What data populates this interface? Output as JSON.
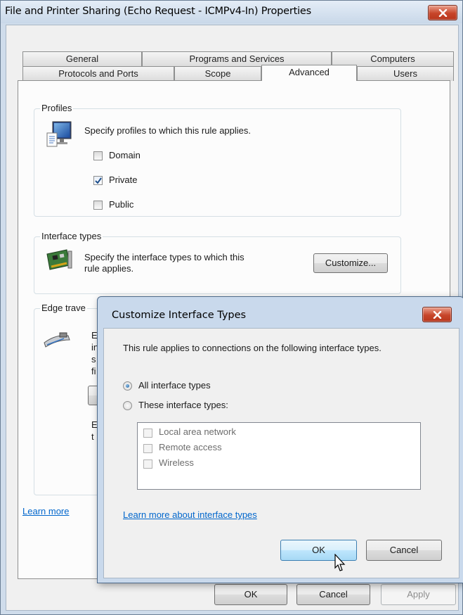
{
  "window": {
    "title": "File and Printer Sharing (Echo Request - ICMPv4-In) Properties",
    "close_label": "close"
  },
  "tabs": {
    "row1": [
      "General",
      "Programs and Services",
      "Computers"
    ],
    "row2": [
      "Protocols and Ports",
      "Scope",
      "Advanced",
      "Users"
    ],
    "active": "Advanced"
  },
  "profiles": {
    "label": "Profiles",
    "description": "Specify profiles to which this rule applies.",
    "items": [
      {
        "label": "Domain",
        "checked": false
      },
      {
        "label": "Private",
        "checked": true
      },
      {
        "label": "Public",
        "checked": false
      }
    ]
  },
  "interface_types": {
    "label": "Interface types",
    "description_line1": "Specify the interface types to which this",
    "description_line2": "rule applies.",
    "customize_button": "Customize..."
  },
  "edge_traversal": {
    "label": "Edge trave",
    "partial_lines": [
      "E",
      "in",
      "s",
      "fi"
    ],
    "partial_line_b1": "E",
    "partial_line_b2": "t"
  },
  "learn_more_partial": "Learn more",
  "footer": {
    "ok": "OK",
    "cancel": "Cancel",
    "apply": "Apply"
  },
  "dialog": {
    "title": "Customize Interface Types",
    "intro": "This rule applies to connections on the following interface types.",
    "options": [
      {
        "label": "All interface types",
        "selected": true
      },
      {
        "label": "These interface types:",
        "selected": false
      }
    ],
    "types": [
      "Local area network",
      "Remote access",
      "Wireless"
    ],
    "learn_more": "Learn more about interface types",
    "ok": "OK",
    "cancel": "Cancel"
  },
  "colors": {
    "accent": "#3c7fb1",
    "link": "#0066cc",
    "close_red": "#c7452a"
  },
  "icons": [
    "close-icon",
    "monitor-profile-icon",
    "network-card-icon",
    "router-icon",
    "checkmark-icon",
    "mouse-pointer-icon"
  ]
}
